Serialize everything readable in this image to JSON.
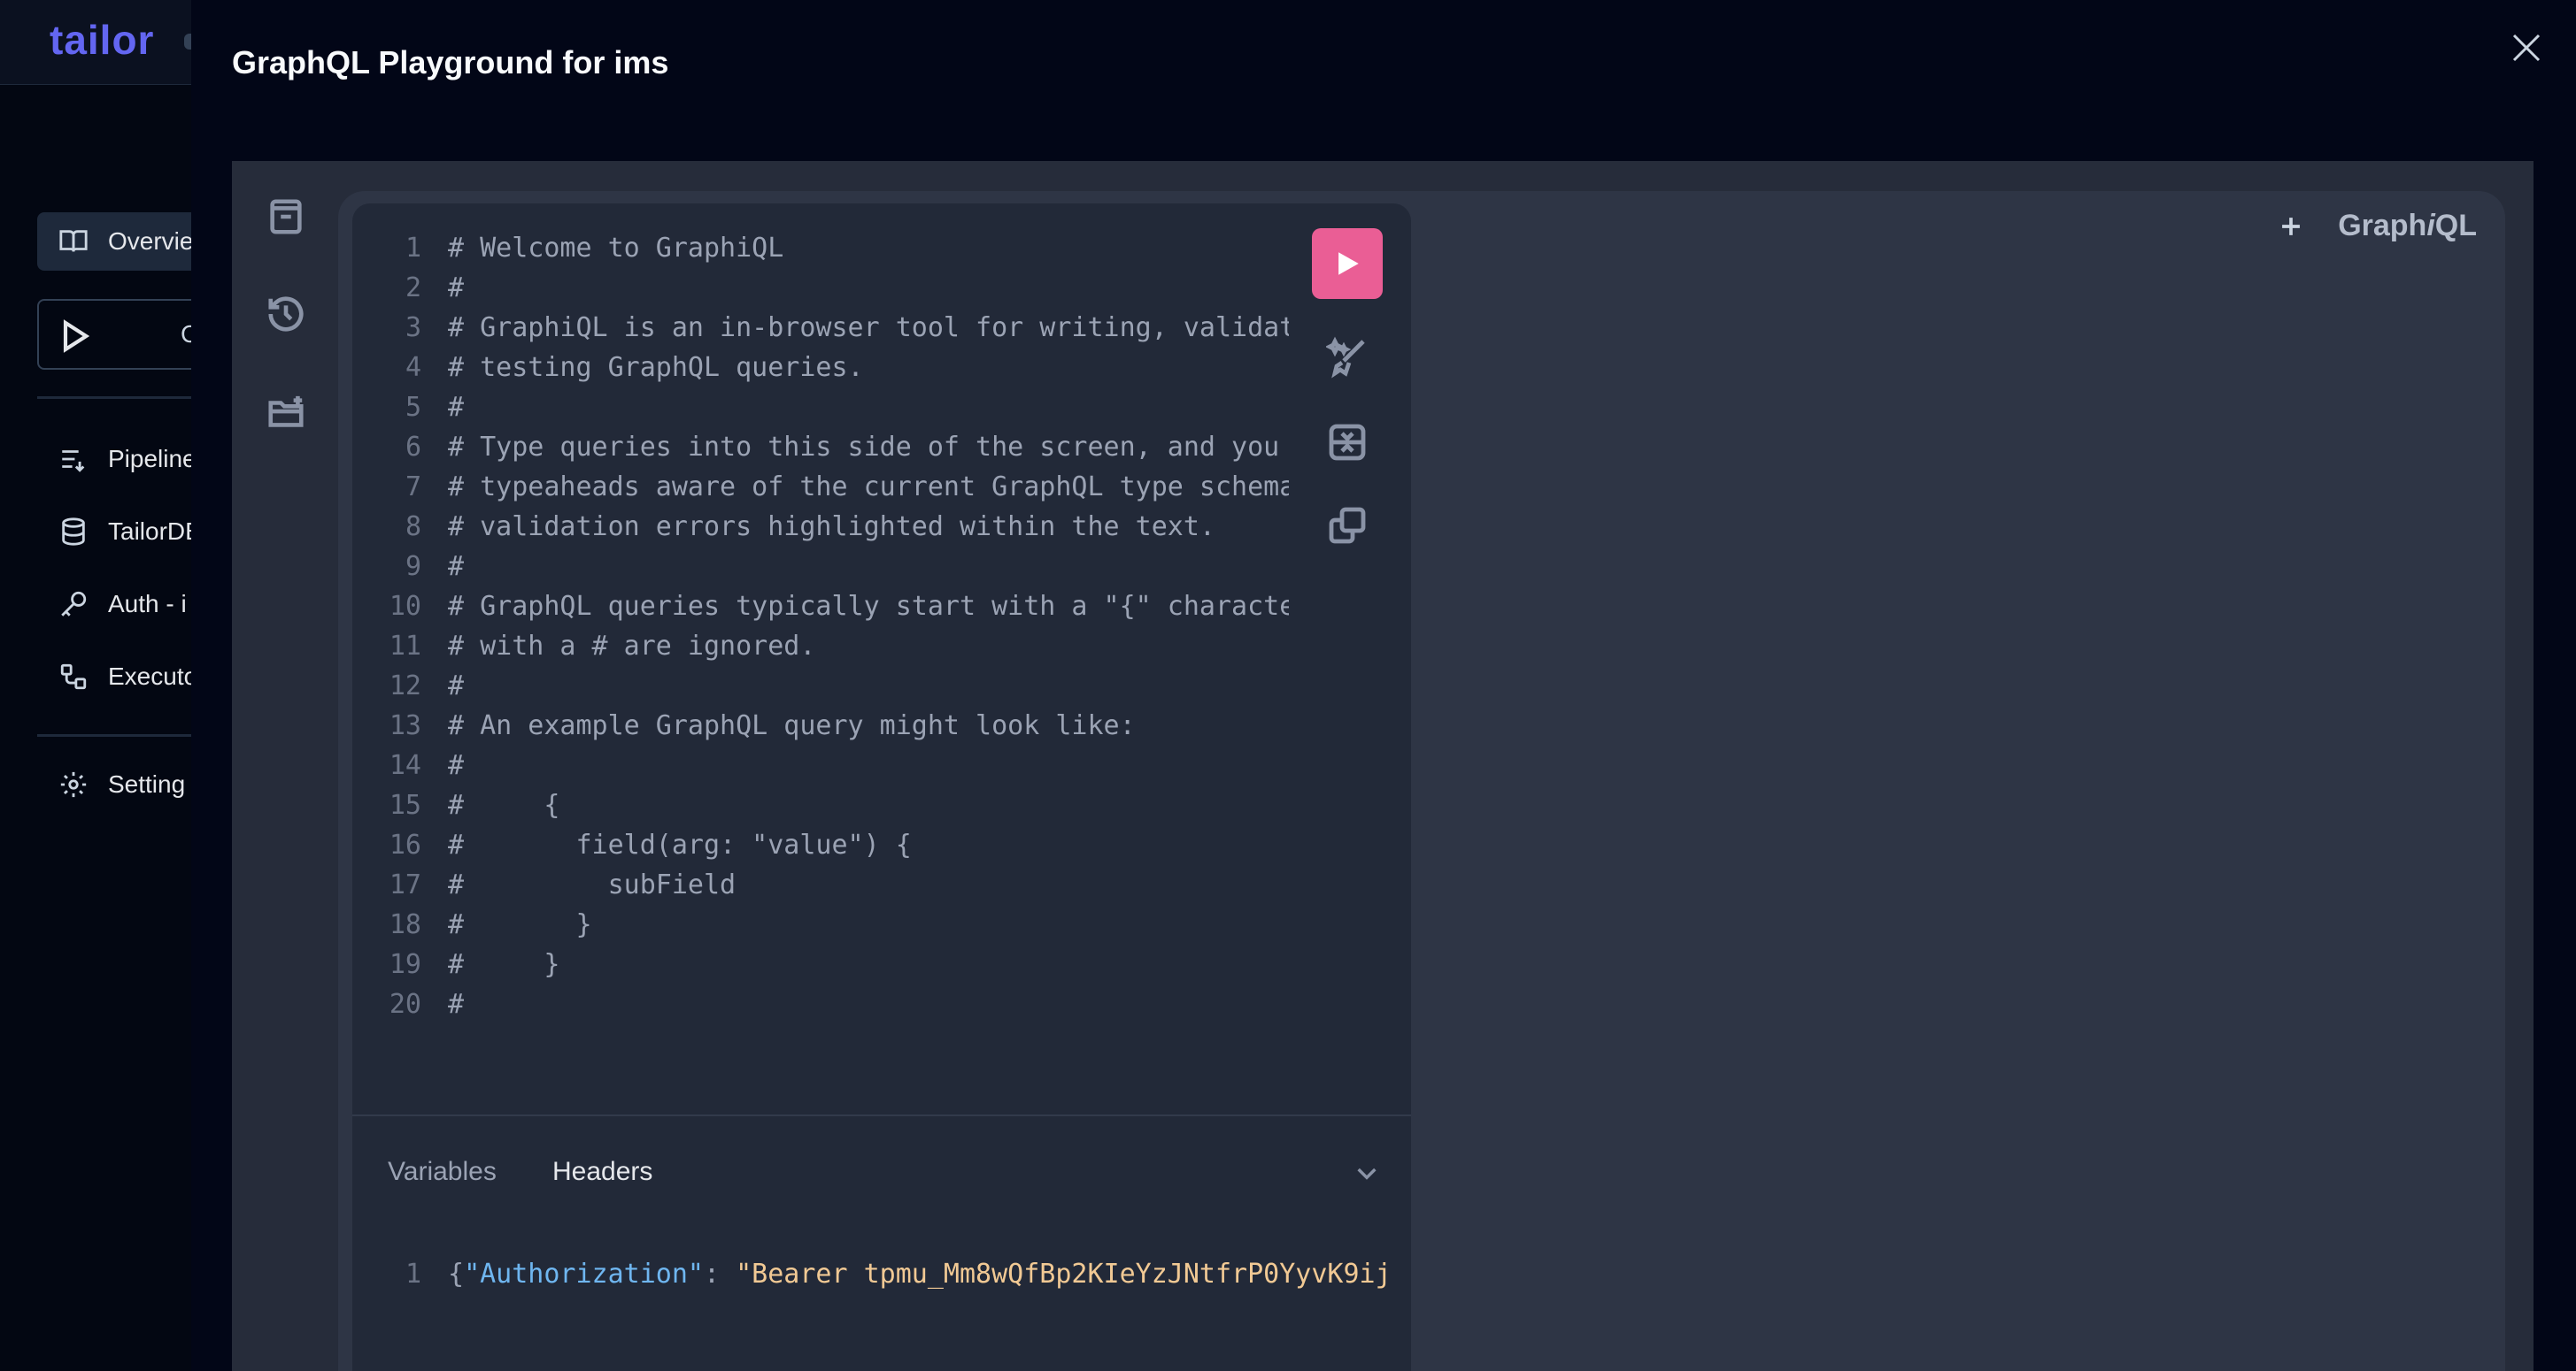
{
  "app": {
    "logo": "tailor"
  },
  "nav": {
    "overview": "Overvie",
    "run_label": "C",
    "pipeline": "Pipeline",
    "tailordb": "TailorDB",
    "auth": "Auth - i",
    "executor": "Executo",
    "settings": "Setting"
  },
  "modal": {
    "title": "GraphQL Playground for ims"
  },
  "editor": {
    "lines": [
      {
        "n": "1",
        "t": "# Welcome to GraphiQL"
      },
      {
        "n": "2",
        "t": "#"
      },
      {
        "n": "3",
        "t": "# GraphiQL is an in-browser tool for writing, validat"
      },
      {
        "n": "4",
        "t": "# testing GraphQL queries."
      },
      {
        "n": "5",
        "t": "#"
      },
      {
        "n": "6",
        "t": "# Type queries into this side of the screen, and you"
      },
      {
        "n": "7",
        "t": "# typeaheads aware of the current GraphQL type schema"
      },
      {
        "n": "8",
        "t": "# validation errors highlighted within the text."
      },
      {
        "n": "9",
        "t": "#"
      },
      {
        "n": "10",
        "t": "# GraphQL queries typically start with a \"{\" characte"
      },
      {
        "n": "11",
        "t": "# with a # are ignored."
      },
      {
        "n": "12",
        "t": "#"
      },
      {
        "n": "13",
        "t": "# An example GraphQL query might look like:"
      },
      {
        "n": "14",
        "t": "#"
      },
      {
        "n": "15",
        "t": "#     {"
      },
      {
        "n": "16",
        "t": "#       field(arg: \"value\") {"
      },
      {
        "n": "17",
        "t": "#         subField"
      },
      {
        "n": "18",
        "t": "#       }"
      },
      {
        "n": "19",
        "t": "#     }"
      },
      {
        "n": "20",
        "t": "#"
      }
    ]
  },
  "bottom": {
    "tab_variables": "Variables",
    "tab_headers": "Headers",
    "header_line_no": "1",
    "brace": "{",
    "key": "\"Authorization\"",
    "colon": ": ",
    "value": "\"Bearer tpmu_Mm8wQfBp2KIeYzJNtfrP0YyvK9ij"
  },
  "brand": {
    "prefix": "Graph",
    "italic": "i",
    "suffix": "QL"
  }
}
